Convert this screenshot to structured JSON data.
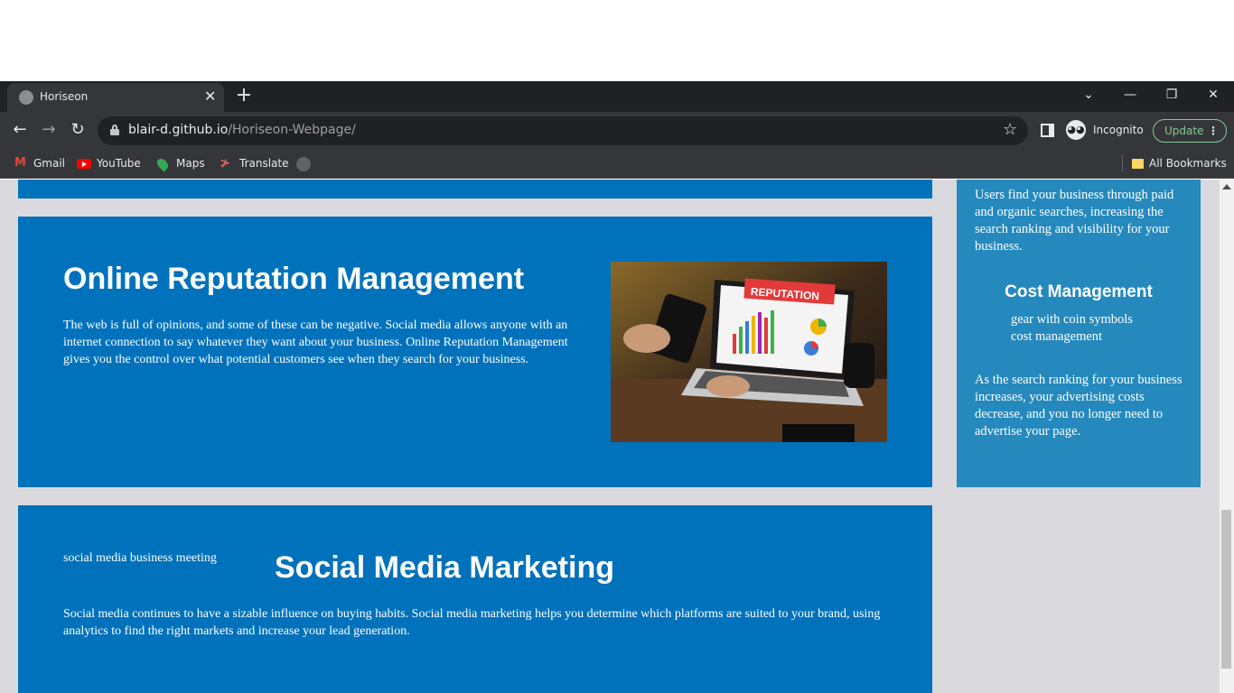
{
  "browser": {
    "tab_title": "Horiseon",
    "tab_close": "✕",
    "new_tab": "+",
    "url_host": "blair-d.github.io",
    "url_path": "/Horiseon-Webpage/",
    "incognito_label": "Incognito",
    "update_label": "Update",
    "bookmarks": [
      {
        "label": "Gmail",
        "icon": "gmail-icon"
      },
      {
        "label": "YouTube",
        "icon": "youtube-icon"
      },
      {
        "label": "Maps",
        "icon": "maps-icon"
      },
      {
        "label": "Translate",
        "icon": "translate-icon"
      },
      {
        "label": "",
        "icon": "github-icon"
      }
    ],
    "all_bookmarks_label": "All Bookmarks"
  },
  "page": {
    "orm": {
      "heading": "Online Reputation Management",
      "body": "The web is full of opinions, and some of these can be negative. Social media allows anyone with an internet connection to say whatever they want about your business. Online Reputation Management gives you the control over what potential customers see when they search for your business.",
      "image_sign": "REPUTATION"
    },
    "smm": {
      "image_alt": "social media business meeting",
      "heading": "Social Media Marketing",
      "body": "Social media continues to have a sizable influence on buying habits. Social media marketing helps you determine which platforms are suited to your brand, using analytics to find the right markets and increase your lead generation."
    },
    "aside": {
      "lead_text": "Users find your business through paid and organic searches, increasing the search ranking and visibility for your business.",
      "cost_heading": "Cost Management",
      "cost_image_alt": "gear with coin symbols cost management",
      "cost_text": "As the search ranking for your business increases, your advertising costs decrease, and you no longer need to advertise your page."
    }
  },
  "colors": {
    "section_blue": "#0072bb",
    "aside_blue": "#2589bd",
    "page_bg": "#d9d9de",
    "chrome_dark": "#202124"
  }
}
